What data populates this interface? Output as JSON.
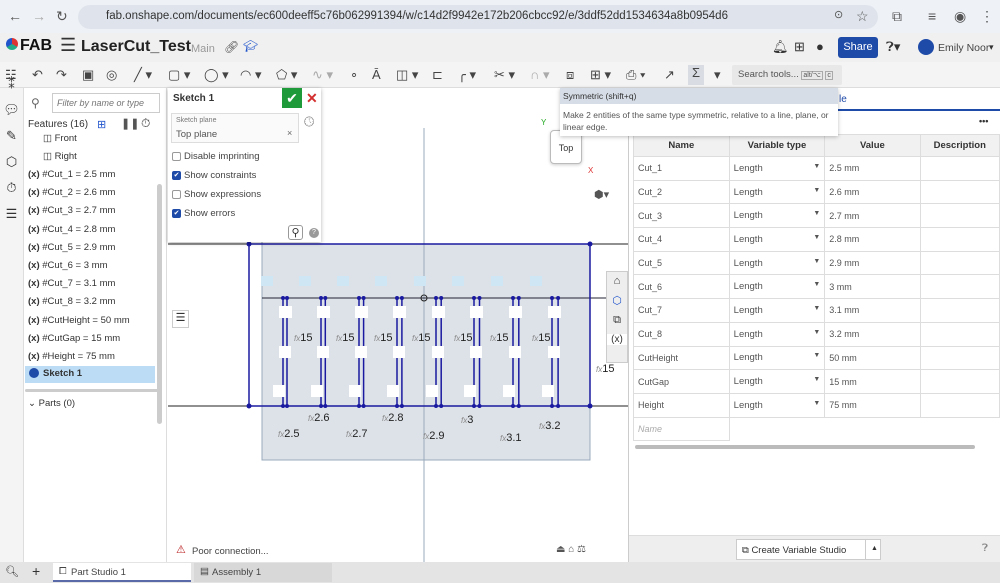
{
  "browser": {
    "url": "fab.onshape.com/documents/ec600deeff5c76b062991394/w/c14d2f9942e172b206cbcc92/e/3ddf52dd1534634a8b0954d6"
  },
  "header": {
    "logo": "FAB",
    "doc_title": "LaserCut_Test",
    "branch": "Main",
    "share": "Share",
    "user": "Emily Noor"
  },
  "toolbar": {
    "search_placeholder": "Search tools...",
    "search_shortcut1": "alt/⌥",
    "search_shortcut2": "c"
  },
  "tooltip": {
    "title": "Symmetric (shift+q)",
    "body": "Make 2 entities of the same type symmetric, relative to a line, plane, or linear edge."
  },
  "features": {
    "filter_placeholder": "Filter by name or type",
    "header": "Features (16)",
    "planes": [
      "Front",
      "Right"
    ],
    "items": [
      "#Cut_1 = 2.5 mm",
      "#Cut_2 = 2.6 mm",
      "#Cut_3 = 2.7 mm",
      "#Cut_4 = 2.8 mm",
      "#Cut_5 = 2.9 mm",
      "#Cut_6 = 3 mm",
      "#Cut_7 = 3.1 mm",
      "#Cut_8 = 3.2 mm",
      "#CutHeight = 50 mm",
      "#CutGap = 15 mm",
      "#Height = 75 mm"
    ],
    "var_icon": "(x)",
    "sketch": "Sketch 1",
    "parts": "Parts (0)"
  },
  "sketch_dialog": {
    "title": "Sketch 1",
    "plane_label": "Sketch plane",
    "plane_value": "Top plane",
    "options": [
      {
        "label": "Disable imprinting",
        "checked": false
      },
      {
        "label": "Show constraints",
        "checked": true
      },
      {
        "label": "Show expressions",
        "checked": false
      },
      {
        "label": "Show errors",
        "checked": true
      }
    ]
  },
  "viewport": {
    "view_cube": "Top",
    "axis_x": "X",
    "axis_y": "Y",
    "status": "Poor connection...",
    "dims_bottom": [
      "2.5",
      "2.6",
      "2.7",
      "2.8",
      "2.9",
      "3",
      "3.1",
      "3.2"
    ],
    "dim_gap": "15",
    "fx": "fx"
  },
  "var_table": {
    "tab_suffix": "le",
    "more": "•••",
    "columns": [
      "Name",
      "Variable type",
      "Value",
      "Description"
    ],
    "rows": [
      [
        "Cut_1",
        "Length",
        "2.5 mm"
      ],
      [
        "Cut_2",
        "Length",
        "2.6 mm"
      ],
      [
        "Cut_3",
        "Length",
        "2.7 mm"
      ],
      [
        "Cut_4",
        "Length",
        "2.8 mm"
      ],
      [
        "Cut_5",
        "Length",
        "2.9 mm"
      ],
      [
        "Cut_6",
        "Length",
        "3 mm"
      ],
      [
        "Cut_7",
        "Length",
        "3.1 mm"
      ],
      [
        "Cut_8",
        "Length",
        "3.2 mm"
      ],
      [
        "CutHeight",
        "Length",
        "50 mm"
      ],
      [
        "CutGap",
        "Length",
        "15 mm"
      ],
      [
        "Height",
        "Length",
        "75 mm"
      ]
    ],
    "new_name_placeholder": "Name",
    "create_button": "Create Variable Studio"
  },
  "tabs": [
    {
      "label": "Part Studio 1",
      "active": true
    },
    {
      "label": "Assembly 1",
      "active": false
    }
  ],
  "colors": {
    "accent": "#1e4aa8",
    "confirm": "#1e9a3a",
    "cancel": "#d32f2f",
    "sketch_line": "#1a1aa0"
  }
}
